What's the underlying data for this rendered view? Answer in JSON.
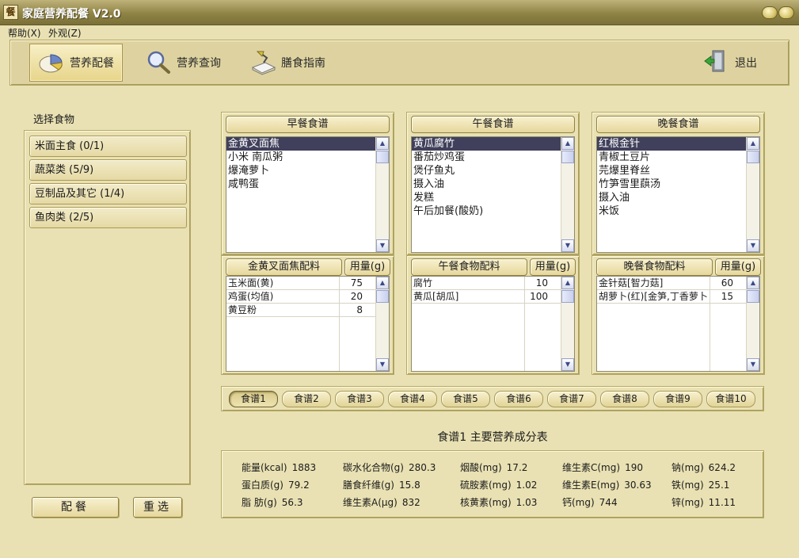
{
  "window": {
    "title": "家庭营养配餐 V2.0",
    "icon_text": "餐"
  },
  "menu": [
    "帮助(X)",
    "外观(Z)"
  ],
  "toolbar": {
    "items": [
      {
        "label": "营养配餐",
        "icon": "pie-chart-icon",
        "active": true
      },
      {
        "label": "营养查询",
        "icon": "magnifier-icon",
        "active": false
      },
      {
        "label": "膳食指南",
        "icon": "book-lamp-icon",
        "active": false
      }
    ],
    "exit_label": "退出"
  },
  "left": {
    "title": "选择食物",
    "categories": [
      "米面主食 (0/1)",
      "蔬菜类 (5/9)",
      "豆制品及其它 (1/4)",
      "鱼肉类 (2/5)"
    ],
    "match_button": "配餐",
    "reset_button": "重选"
  },
  "meals": [
    {
      "header": "早餐食谱",
      "items": [
        "金黄叉面焦",
        "小米 南瓜粥",
        "爆淹萝卜",
        "咸鸭蛋"
      ],
      "selected": 0,
      "ingredients_header": "金黄叉面焦配料",
      "amount_header": "用量(g)",
      "ingredients": [
        {
          "name": "玉米面(黄)",
          "amount": "75"
        },
        {
          "name": "鸡蛋(均值)",
          "amount": "20"
        },
        {
          "name": "黄豆粉",
          "amount": "8"
        }
      ]
    },
    {
      "header": "午餐食谱",
      "items": [
        "黄瓜腐竹",
        "番茄炒鸡蛋",
        "煲仔鱼丸",
        "摄入油",
        "发糕",
        "午后加餐(酸奶)"
      ],
      "selected": 0,
      "ingredients_header": "午餐食物配料",
      "amount_header": "用量(g)",
      "ingredients": [
        {
          "name": "腐竹",
          "amount": "10"
        },
        {
          "name": "黄瓜[胡瓜]",
          "amount": "100"
        }
      ]
    },
    {
      "header": "晚餐食谱",
      "items": [
        "红根金针",
        "青椒土豆片",
        "芫爆里脊丝",
        "竹笋雪里蕻汤",
        "摄入油",
        "米饭"
      ],
      "selected": 0,
      "ingredients_header": "晚餐食物配料",
      "amount_header": "用量(g)",
      "ingredients": [
        {
          "name": "金针菇[智力菇]",
          "amount": "60"
        },
        {
          "name": "胡萝卜(红)[金笋,丁香萝卜]",
          "amount": "15"
        }
      ]
    }
  ],
  "recipe_tabs": [
    "食谱1",
    "食谱2",
    "食谱3",
    "食谱4",
    "食谱5",
    "食谱6",
    "食谱7",
    "食谱8",
    "食谱9",
    "食谱10"
  ],
  "recipe_tab_active": 0,
  "nutrition": {
    "title": "食谱1 主要营养成分表",
    "columns": [
      [
        {
          "label": "能量(kcal)",
          "value": "1883"
        },
        {
          "label": "蛋白质(g)",
          "value": "79.2"
        },
        {
          "label": "脂 肪(g)",
          "value": "56.3"
        }
      ],
      [
        {
          "label": "碳水化合物(g)",
          "value": "280.3"
        },
        {
          "label": "膳食纤维(g)",
          "value": "15.8"
        },
        {
          "label": "维生素A(μg)",
          "value": "832"
        }
      ],
      [
        {
          "label": "烟酸(mg)",
          "value": "17.2"
        },
        {
          "label": "硫胺素(mg)",
          "value": "1.02"
        },
        {
          "label": "核黄素(mg)",
          "value": "1.03"
        }
      ],
      [
        {
          "label": "维生素C(mg)",
          "value": "190"
        },
        {
          "label": "维生素E(mg)",
          "value": "30.63"
        },
        {
          "label": "钙(mg)",
          "value": "744"
        }
      ],
      [
        {
          "label": "钠(mg)",
          "value": "624.2"
        },
        {
          "label": "铁(mg)",
          "value": "25.1"
        },
        {
          "label": "锌(mg)",
          "value": "11.11"
        }
      ]
    ]
  }
}
